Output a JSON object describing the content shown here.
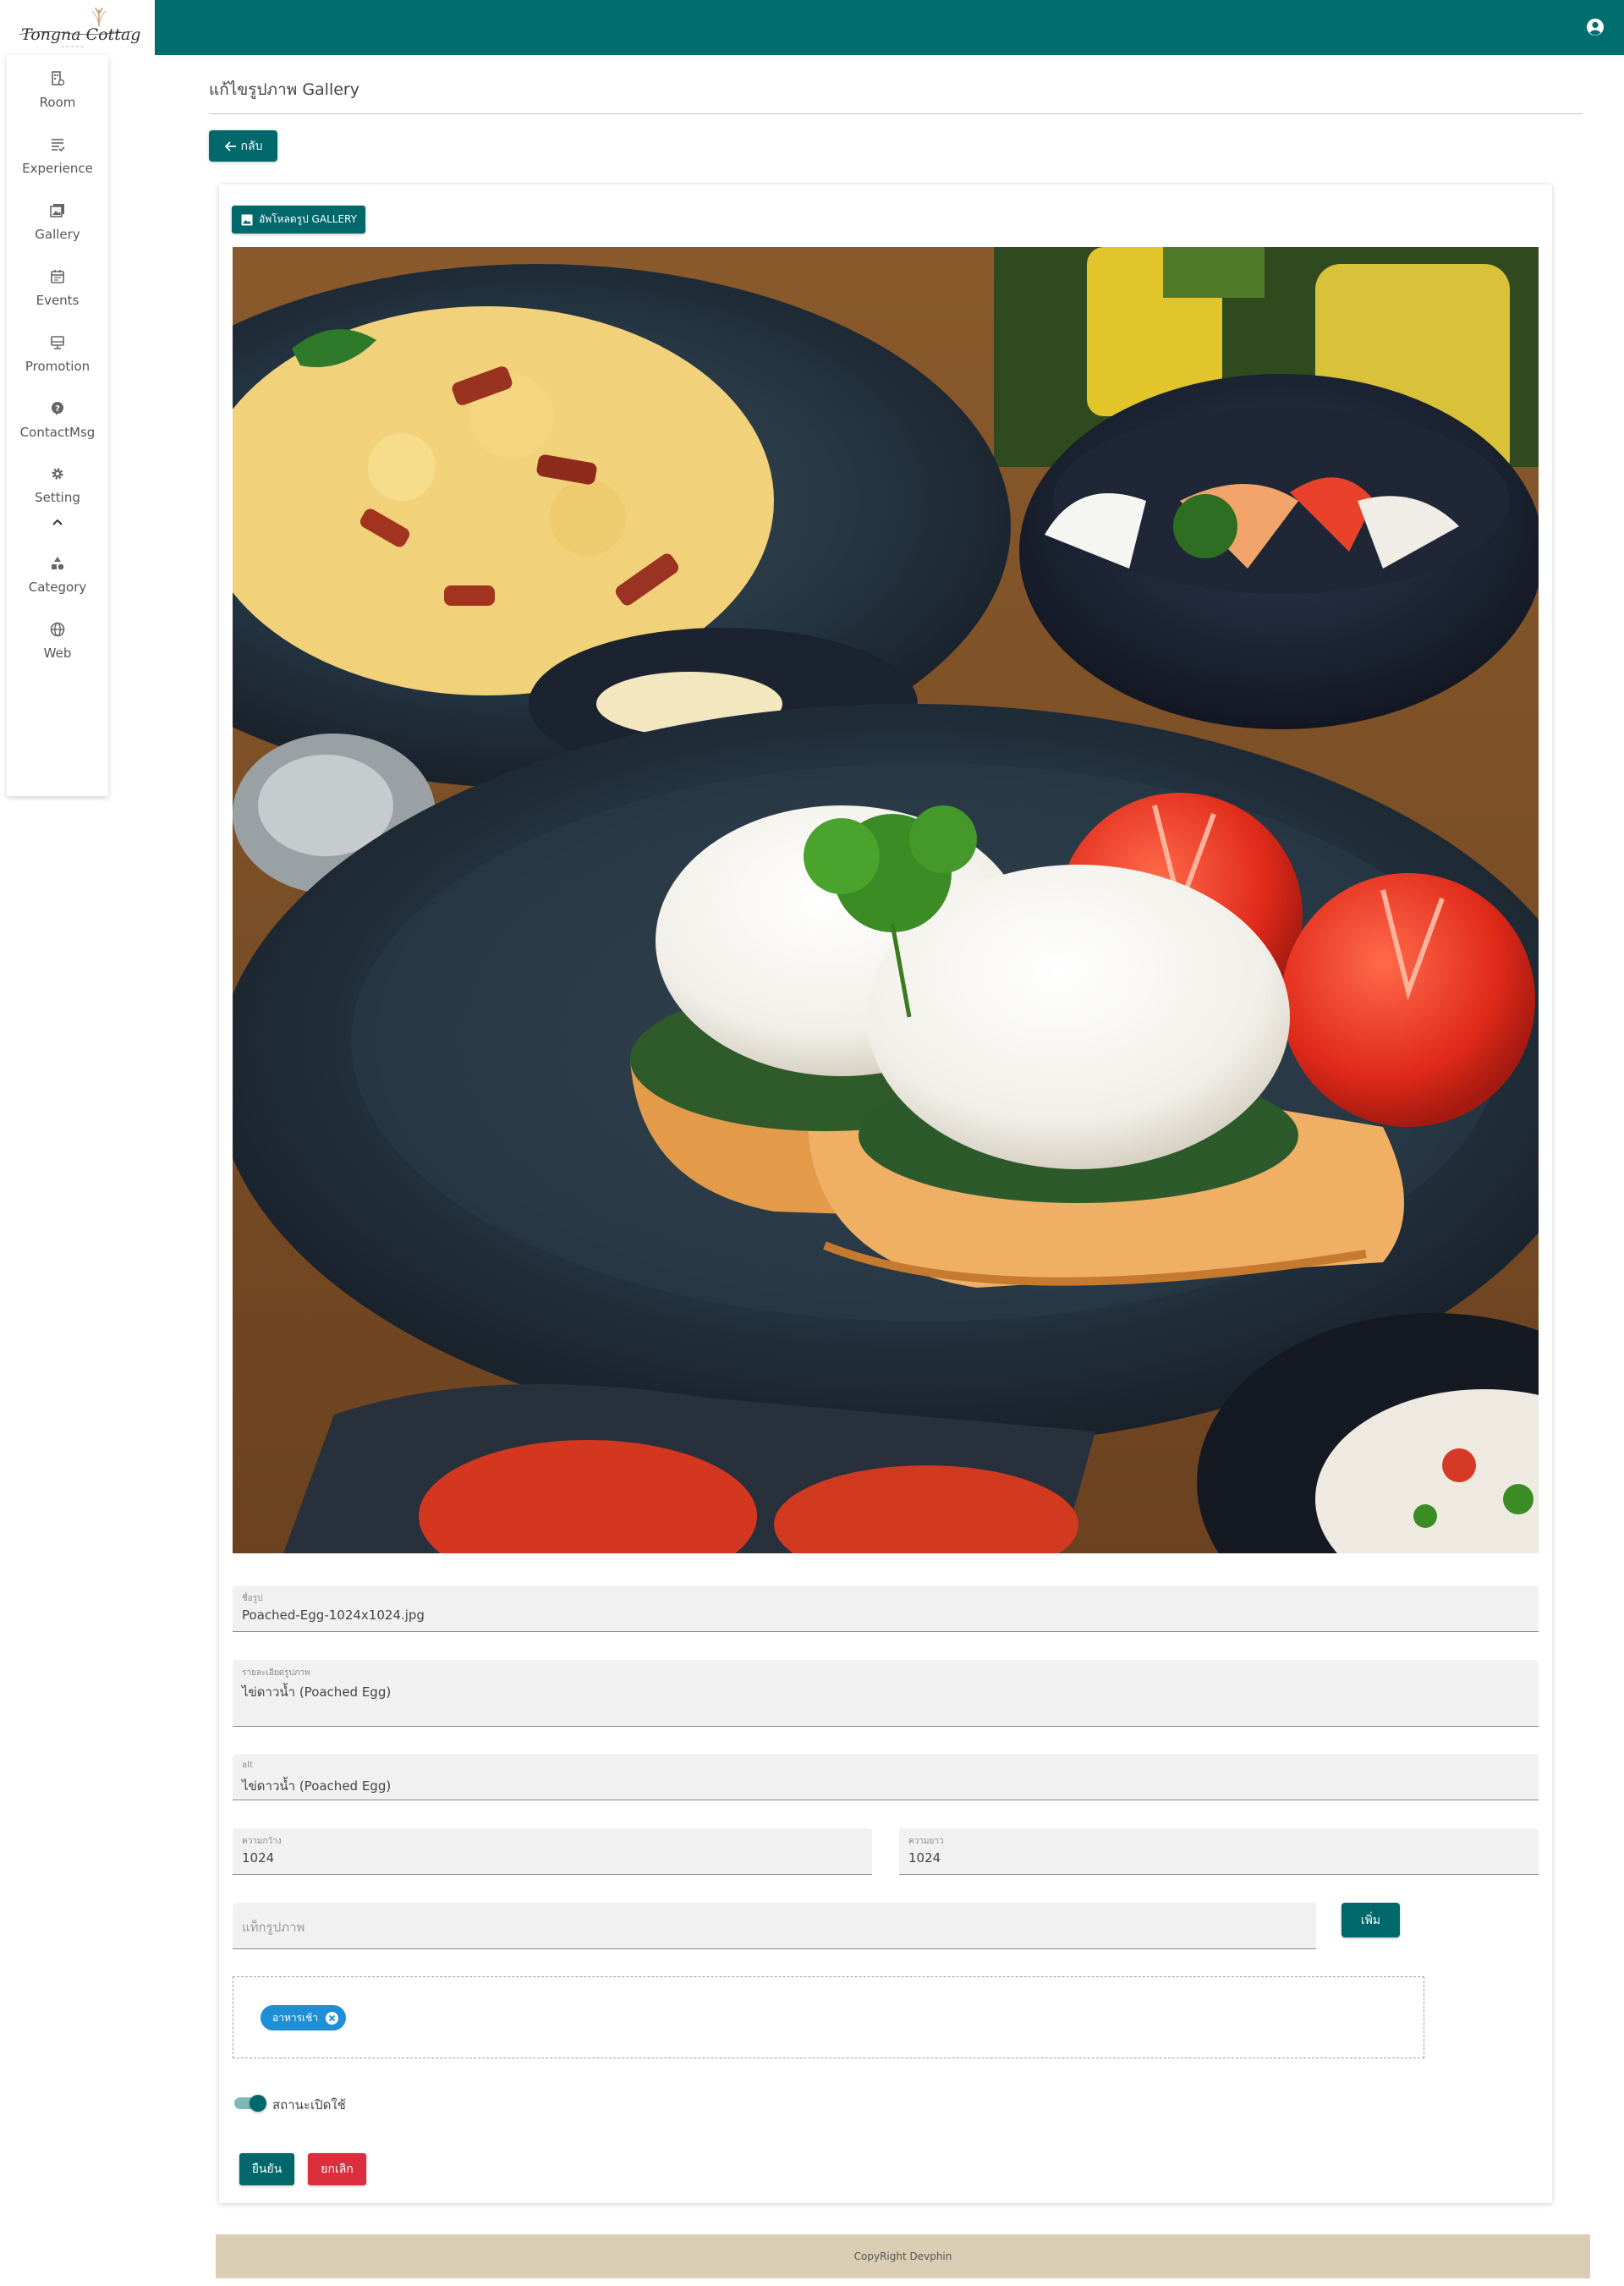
{
  "header": {
    "logo_text": "Tongna Cottage",
    "user_icon": "user-circle-icon",
    "bar_color": "#006d6f"
  },
  "sidebar": {
    "items": [
      {
        "label": "Room",
        "icon": "room-icon"
      },
      {
        "label": "Experience",
        "icon": "experience-icon"
      },
      {
        "label": "Gallery",
        "icon": "gallery-icon"
      },
      {
        "label": "Events",
        "icon": "calendar-icon"
      },
      {
        "label": "Promotion",
        "icon": "monitor-icon"
      },
      {
        "label": "ContactMsg",
        "icon": "question-icon"
      },
      {
        "label": "Setting",
        "icon": "gear-icon"
      },
      {
        "label": "Category",
        "icon": "shapes-icon"
      },
      {
        "label": "Web",
        "icon": "globe-icon"
      }
    ],
    "collapse_icon": "chevron-up-icon"
  },
  "page": {
    "title": "แก้ไขรูปภาพ Gallery",
    "back_label": "กลับ"
  },
  "form": {
    "upload_label": "อัพโหลดรูป GALLERY",
    "filename": {
      "label": "ชื่อรูป",
      "value": "Poached-Egg-1024x1024.jpg"
    },
    "description": {
      "label": "รายละเอียดรูปภาพ",
      "value": "ไข่ดาวน้ำ (Poached Egg)"
    },
    "alt": {
      "label": "alt",
      "value": "ไข่ดาวน้ำ (Poached Egg)"
    },
    "width": {
      "label": "ความกว้าง",
      "value": "1024"
    },
    "height": {
      "label": "ความยาว",
      "value": "1024"
    },
    "tag_input": {
      "placeholder": "แท็กรูปภาพ"
    },
    "add_label": "เพิ่ม",
    "tags": [
      "อาหารเช้า"
    ],
    "status_label": "สถานะเปิดใช้",
    "status_on": true,
    "confirm_label": "ยืนยัน",
    "cancel_label": "ยกเลิก"
  },
  "footer": {
    "text": "CopyRight Devphin"
  },
  "colors": {
    "primary": "#00676a",
    "danger": "#dc2f3e",
    "chip": "#1e8fd6",
    "footer_bg": "#d9cdb4"
  }
}
